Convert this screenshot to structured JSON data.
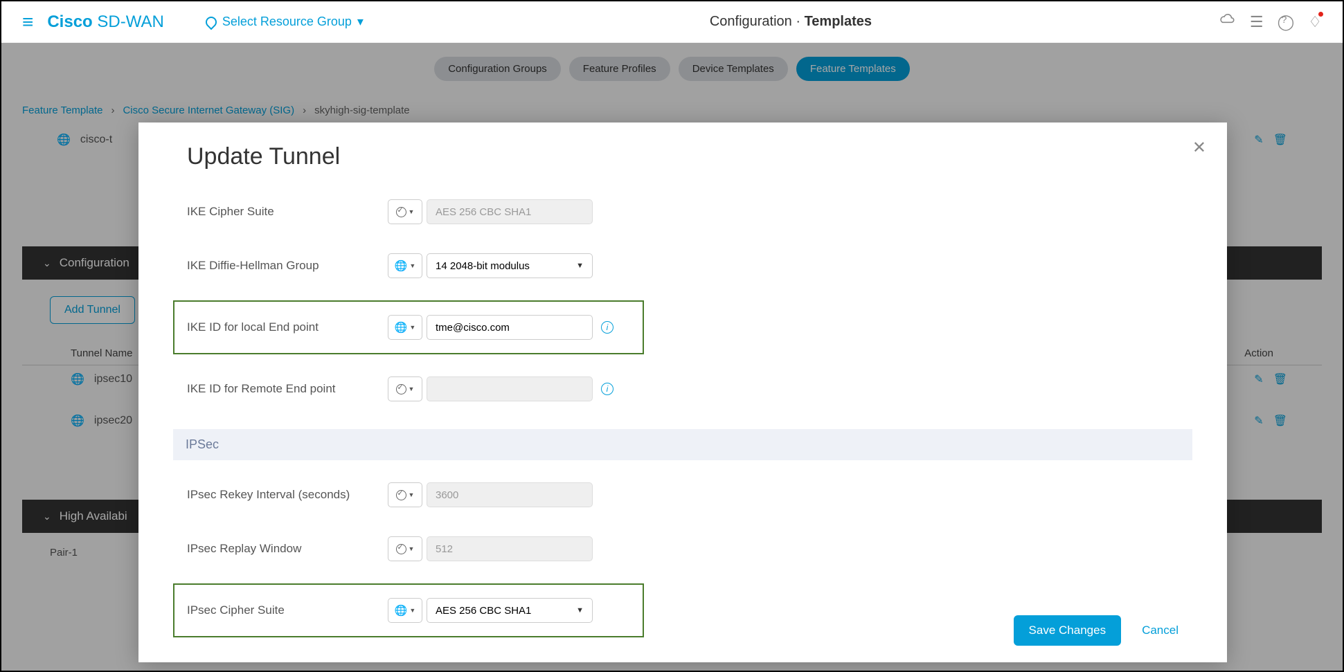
{
  "header": {
    "brand_bold": "Cisco",
    "brand_thin": "SD-WAN",
    "resource_group": "Select Resource Group",
    "crumb_section": "Configuration",
    "crumb_page": "Templates"
  },
  "pills": {
    "p1": "Configuration Groups",
    "p2": "Feature Profiles",
    "p3": "Device Templates",
    "p4": "Feature Templates"
  },
  "breadcrumbs": {
    "b1": "Feature Template",
    "b2": "Cisco Secure Internet Gateway (SIG)",
    "b3": "skyhigh-sig-template"
  },
  "bg": {
    "row_cisco": "cisco-t",
    "section_config": "Configuration",
    "add_tunnel": "Add Tunnel",
    "col_name": "Tunnel Name",
    "col_action": "Action",
    "row_ipsec10": "ipsec10",
    "row_ipsec20": "ipsec20",
    "section_ha": "High Availabi",
    "pair": "Pair-1"
  },
  "modal": {
    "title": "Update Tunnel",
    "ike_cipher_label": "IKE Cipher Suite",
    "ike_cipher_value": "AES 256 CBC SHA1",
    "ike_dh_label": "IKE Diffie-Hellman Group",
    "ike_dh_value": "14 2048-bit modulus",
    "ike_local_label": "IKE ID for local End point",
    "ike_local_value": "tme@cisco.com",
    "ike_remote_label": "IKE ID for Remote End point",
    "ike_remote_value": "",
    "ipsec_section": "IPSec",
    "ipsec_rekey_label": "IPsec Rekey Interval (seconds)",
    "ipsec_rekey_value": "3600",
    "ipsec_replay_label": "IPsec Replay Window",
    "ipsec_replay_value": "512",
    "ipsec_cipher_label": "IPsec Cipher Suite",
    "ipsec_cipher_value": "AES 256 CBC SHA1",
    "save": "Save Changes",
    "cancel": "Cancel"
  }
}
